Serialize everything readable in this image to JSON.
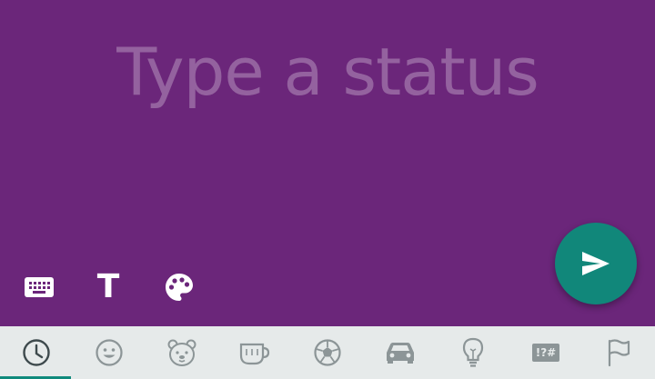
{
  "editor": {
    "placeholder": "Type a status",
    "background_color": "#6b267a"
  },
  "toolbar": {
    "keyboard_icon": "keyboard-icon",
    "text_icon": "text-format-icon",
    "text_label": "T",
    "palette_icon": "palette-icon"
  },
  "fab": {
    "icon": "send-icon",
    "color": "#11877a"
  },
  "emoji_bar": {
    "active_index": 0,
    "accent_color": "#0f8a7c",
    "tabs": [
      {
        "icon": "recent-clock-icon"
      },
      {
        "icon": "smiley-icon"
      },
      {
        "icon": "bear-icon"
      },
      {
        "icon": "coffee-cup-icon"
      },
      {
        "icon": "soccer-ball-icon"
      },
      {
        "icon": "car-icon"
      },
      {
        "icon": "lightbulb-icon"
      },
      {
        "icon": "symbols-icon",
        "label": "!?#"
      },
      {
        "icon": "flag-icon"
      }
    ]
  }
}
